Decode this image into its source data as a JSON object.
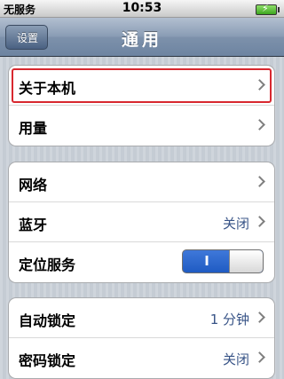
{
  "status": {
    "carrier": "无服务",
    "time": "10:53"
  },
  "nav": {
    "back_label": "设置",
    "title": "通用"
  },
  "group1": [
    {
      "label": "关于本机"
    },
    {
      "label": "用量"
    }
  ],
  "group2": [
    {
      "label": "网络"
    },
    {
      "label": "蓝牙",
      "value": "关闭"
    },
    {
      "label": "定位服务",
      "toggle_label": "I",
      "toggle_state": "on"
    }
  ],
  "group3": [
    {
      "label": "自动锁定",
      "value": "1 分钟"
    },
    {
      "label": "密码锁定",
      "value": "关闭"
    }
  ],
  "colors": {
    "highlight": "#d8282f",
    "value_text": "#385487",
    "toggle_on": "#1f5bc3"
  }
}
